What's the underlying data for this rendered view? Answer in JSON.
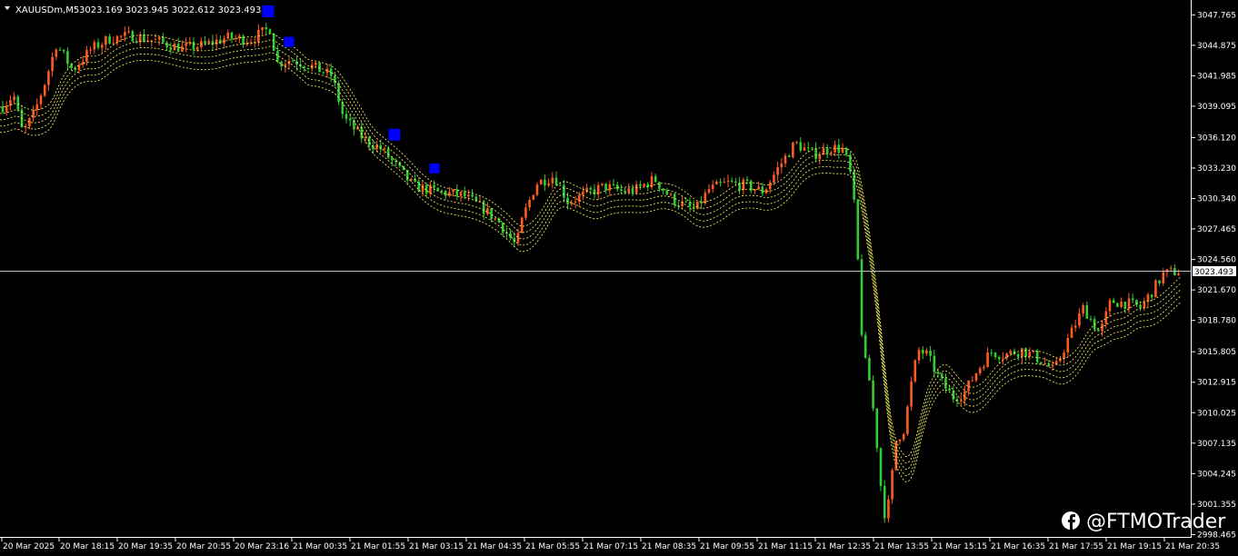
{
  "header": {
    "menu_icon": "triangle-down-icon",
    "symbol_label": "XAUUSDm,M5",
    "ohlc_text": "3023.169 3023.945 3022.612 3023.493"
  },
  "watermark": {
    "icon": "facebook-icon",
    "text": "@FTMOTrader"
  },
  "colors": {
    "background": "#000000",
    "axis": "#ffffff",
    "bull_candle": "#ff5a1f",
    "bear_candle": "#32cd32",
    "band": "#ffff66",
    "signal": "#0000ff",
    "price_line": "#c0c0c0"
  },
  "chart_data": {
    "type": "candlestick",
    "symbol": "XAUUSDm",
    "timeframe": "M5",
    "current_price": 3023.493,
    "current_price_label": "3023.493",
    "y_range": [
      2998.5,
      3049.0
    ],
    "y_ticks": [
      "3047.765",
      "3044.875",
      "3041.985",
      "3039.095",
      "3036.120",
      "3033.230",
      "3030.340",
      "3027.465",
      "3024.560",
      "3021.670",
      "3018.780",
      "3015.805",
      "3012.915",
      "3010.025",
      "3007.135",
      "3004.245",
      "3001.355",
      "2998.465"
    ],
    "x_ticks": [
      "20 Mar 2025",
      "20 Mar 18:15",
      "20 Mar 19:35",
      "20 Mar 20:55",
      "20 Mar 23:16",
      "21 Mar 00:35",
      "21 Mar 01:55",
      "21 Mar 03:15",
      "21 Mar 04:35",
      "21 Mar 05:55",
      "21 Mar 07:15",
      "21 Mar 08:35",
      "21 Mar 09:55",
      "21 Mar 11:15",
      "21 Mar 12:35",
      "21 Mar 13:55",
      "21 Mar 15:15",
      "21 Mar 16:35",
      "21 Mar 17:55",
      "21 Mar 19:15",
      "21 Mar 20:35"
    ],
    "close_path": [
      [
        0,
        3038.8
      ],
      [
        15,
        3040.2
      ],
      [
        25,
        3036.5
      ],
      [
        38,
        3038.5
      ],
      [
        50,
        3041.5
      ],
      [
        62,
        3045.0
      ],
      [
        80,
        3042.5
      ],
      [
        100,
        3044.5
      ],
      [
        120,
        3045.5
      ],
      [
        145,
        3045.8
      ],
      [
        175,
        3045.2
      ],
      [
        200,
        3044.6
      ],
      [
        225,
        3044.9
      ],
      [
        250,
        3045.6
      ],
      [
        275,
        3045.4
      ],
      [
        297,
        3046.5
      ],
      [
        305,
        3043.2
      ],
      [
        320,
        3043.5
      ],
      [
        340,
        3043.0
      ],
      [
        365,
        3042.0
      ],
      [
        378,
        3038.0
      ],
      [
        400,
        3036.0
      ],
      [
        420,
        3035.0
      ],
      [
        440,
        3033.0
      ],
      [
        455,
        3031.5
      ],
      [
        480,
        3031.0
      ],
      [
        510,
        3030.6
      ],
      [
        530,
        3029.5
      ],
      [
        550,
        3028.0
      ],
      [
        568,
        3025.8
      ],
      [
        575,
        3028.5
      ],
      [
        590,
        3031.8
      ],
      [
        610,
        3032.5
      ],
      [
        625,
        3030.0
      ],
      [
        645,
        3030.8
      ],
      [
        665,
        3031.5
      ],
      [
        685,
        3031.0
      ],
      [
        700,
        3031.2
      ],
      [
        720,
        3032.2
      ],
      [
        740,
        3030.2
      ],
      [
        765,
        3029.2
      ],
      [
        780,
        3031.2
      ],
      [
        800,
        3031.8
      ],
      [
        820,
        3031.6
      ],
      [
        840,
        3031.0
      ],
      [
        858,
        3033.5
      ],
      [
        875,
        3035.6
      ],
      [
        895,
        3034.5
      ],
      [
        915,
        3035.2
      ],
      [
        928,
        3035.0
      ],
      [
        935,
        3033.0
      ],
      [
        942,
        3028.0
      ],
      [
        946,
        3020.0
      ],
      [
        950,
        3015.5
      ],
      [
        958,
        3012.5
      ],
      [
        966,
        3006.0
      ],
      [
        972,
        3000.3
      ],
      [
        978,
        3001.5
      ],
      [
        986,
        3007.5
      ],
      [
        995,
        3008.5
      ],
      [
        1002,
        3012.5
      ],
      [
        1010,
        3016.0
      ],
      [
        1020,
        3015.5
      ],
      [
        1035,
        3013.0
      ],
      [
        1048,
        3011.5
      ],
      [
        1060,
        3011.8
      ],
      [
        1075,
        3014.0
      ],
      [
        1090,
        3015.8
      ],
      [
        1105,
        3015.5
      ],
      [
        1125,
        3016.0
      ],
      [
        1145,
        3015.0
      ],
      [
        1160,
        3014.0
      ],
      [
        1175,
        3017.0
      ],
      [
        1192,
        3020.0
      ],
      [
        1210,
        3017.5
      ],
      [
        1222,
        3020.6
      ],
      [
        1240,
        3020.4
      ],
      [
        1255,
        3020.0
      ],
      [
        1268,
        3021.6
      ],
      [
        1280,
        3023.2
      ],
      [
        1300,
        3023.5
      ]
    ],
    "signals": [
      {
        "x": 295,
        "price": 3048.1,
        "size": 13
      },
      {
        "x": 318,
        "price": 3045.2,
        "size": 11
      },
      {
        "x": 434,
        "price": 3036.4,
        "size": 13
      },
      {
        "x": 478,
        "price": 3033.2,
        "size": 11
      }
    ],
    "bands": {
      "mid_shift": -1.0,
      "offsets": [
        0,
        0.6,
        -0.6,
        1.2,
        -1.2
      ]
    }
  }
}
